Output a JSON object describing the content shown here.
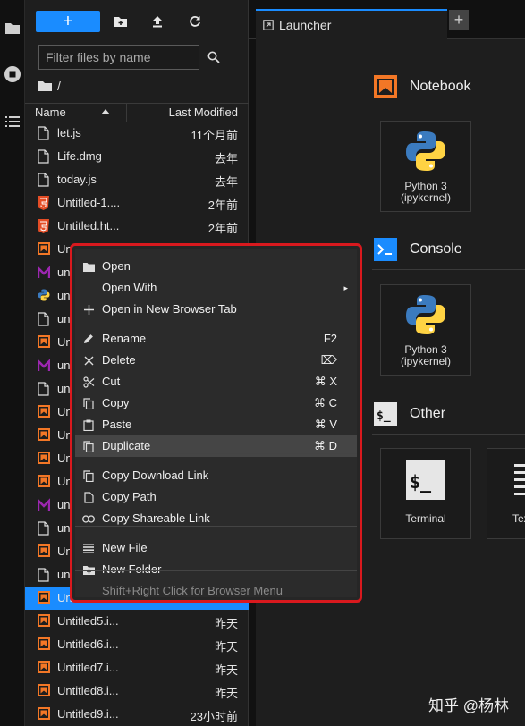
{
  "file_browser": {
    "filter_placeholder": "Filter files by name",
    "breadcrumb": "/",
    "columns": {
      "name": "Name",
      "modified": "Last Modified"
    },
    "files": [
      {
        "name": "let.js",
        "modified": "11个月前",
        "type": "file"
      },
      {
        "name": "Life.dmg",
        "modified": "去年",
        "type": "file"
      },
      {
        "name": "today.js",
        "modified": "去年",
        "type": "file"
      },
      {
        "name": "Untitled-1....",
        "modified": "2年前",
        "type": "html"
      },
      {
        "name": "Untitled.ht...",
        "modified": "2年前",
        "type": "html"
      },
      {
        "name": "Un",
        "modified": "",
        "type": "notebook"
      },
      {
        "name": "un",
        "modified": "",
        "type": "markdown"
      },
      {
        "name": "un",
        "modified": "",
        "type": "python"
      },
      {
        "name": "un",
        "modified": "",
        "type": "file"
      },
      {
        "name": "Un",
        "modified": "",
        "type": "notebook"
      },
      {
        "name": "un",
        "modified": "",
        "type": "markdown"
      },
      {
        "name": "un",
        "modified": "",
        "type": "file"
      },
      {
        "name": "Un",
        "modified": "",
        "type": "notebook"
      },
      {
        "name": "Un",
        "modified": "",
        "type": "notebook"
      },
      {
        "name": "Un",
        "modified": "",
        "type": "notebook"
      },
      {
        "name": "Un",
        "modified": "",
        "type": "notebook"
      },
      {
        "name": "un",
        "modified": "",
        "type": "markdown"
      },
      {
        "name": "un",
        "modified": "",
        "type": "file"
      },
      {
        "name": "Un",
        "modified": "",
        "type": "notebook"
      },
      {
        "name": "un",
        "modified": "",
        "type": "file"
      },
      {
        "name": "Un",
        "modified": "",
        "type": "notebook",
        "selected": true
      },
      {
        "name": "Untitled5.i...",
        "modified": "昨天",
        "type": "notebook"
      },
      {
        "name": "Untitled6.i...",
        "modified": "昨天",
        "type": "notebook"
      },
      {
        "name": "Untitled7.i...",
        "modified": "昨天",
        "type": "notebook"
      },
      {
        "name": "Untitled8.i...",
        "modified": "昨天",
        "type": "notebook"
      },
      {
        "name": "Untitled9.i...",
        "modified": "23小时前",
        "type": "notebook"
      }
    ]
  },
  "tabs": {
    "launcher": "Launcher"
  },
  "launcher": {
    "notebook_section": "Notebook",
    "console_section": "Console",
    "other_section": "Other",
    "notebook_card": {
      "line1": "Python 3",
      "line2": "(ipykernel)"
    },
    "console_card": {
      "line1": "Python 3",
      "line2": "(ipykernel)"
    },
    "terminal_card": "Terminal",
    "text_card_partial": "Tex"
  },
  "context_menu": {
    "items": [
      {
        "label": "Open",
        "shortcut": "",
        "icon": "folder-icon"
      },
      {
        "label": "Open With",
        "shortcut": "",
        "submenu": true
      },
      {
        "label": "Open in New Browser Tab",
        "shortcut": "",
        "icon": "plus-icon"
      },
      {
        "label": "Rename",
        "shortcut": "F2",
        "icon": "pencil-icon"
      },
      {
        "label": "Delete",
        "shortcut": "⌦",
        "icon": "close-icon"
      },
      {
        "label": "Cut",
        "shortcut": "⌘ X",
        "icon": "scissors-icon"
      },
      {
        "label": "Copy",
        "shortcut": "⌘ C",
        "icon": "copy-icon"
      },
      {
        "label": "Paste",
        "shortcut": "⌘ V",
        "icon": "paste-icon"
      },
      {
        "label": "Duplicate",
        "shortcut": "⌘ D",
        "icon": "duplicate-icon",
        "active": true
      },
      {
        "label": "Copy Download Link",
        "shortcut": "",
        "icon": "copy-icon"
      },
      {
        "label": "Copy Path",
        "shortcut": "",
        "icon": "file-icon"
      },
      {
        "label": "Copy Shareable Link",
        "shortcut": "",
        "icon": "link-icon"
      },
      {
        "label": "New File",
        "shortcut": "",
        "icon": "list-icon"
      },
      {
        "label": "New Folder",
        "shortcut": "",
        "icon": "new-folder-icon"
      },
      {
        "label": "Shift+Right Click for Browser Menu",
        "shortcut": "",
        "disabled": true
      }
    ]
  },
  "watermark": "知乎 @杨林",
  "colors": {
    "accent": "#1a8cff",
    "highlight_border": "#d9191e",
    "notebook_orange": "#f37726",
    "markdown_purple": "#9c27b0",
    "console_blue": "#1a8cff"
  }
}
